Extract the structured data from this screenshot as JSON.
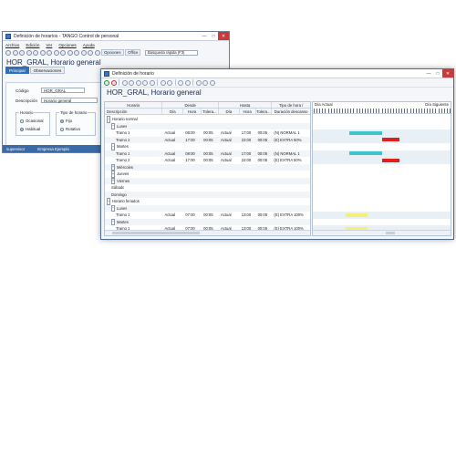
{
  "colors": {
    "teal": "#3fc4cc",
    "red": "#e0201c",
    "yellow": "#f3f07a",
    "accent": "#2f6fb5"
  },
  "bg_window": {
    "title": "Definición de horarios - TANGO Control de personal",
    "menu": [
      "Archivo",
      "Edición",
      "Ver",
      "Opciones",
      "Ayuda"
    ],
    "toolbar": {
      "opciones": "Opciones",
      "office": "Office",
      "search_placeholder": "Búsqueda rápida (F3)"
    },
    "record_title": "HOR_GRAL, Horario general",
    "tabs": [
      "Principal",
      "Observaciones"
    ],
    "form": {
      "codigo_label": "Código",
      "codigo_value": "HOR_GRAL",
      "descripcion_label": "Descripción",
      "descripcion_value": "Horario general",
      "horario_group": "Horario",
      "horario_opt1": "Ocasional",
      "horario_opt2": "Habitual",
      "tipo_group": "Tipo de horario",
      "tipo_opt1": "Fijo",
      "tipo_opt2": "Rotativo"
    },
    "status": {
      "user": "supervisor",
      "company": "Empresa Ejemplo"
    }
  },
  "fg_window": {
    "title": "Definición de horario",
    "record_title": "HOR_GRAL, Horario general",
    "grid": {
      "group_headers": [
        "Horario",
        "Desde",
        "Hasta",
        "Tipo de hora /"
      ],
      "columns": [
        "Descripción",
        "Día",
        "Hora",
        "Tolera...",
        "Día",
        "Hora",
        "Tolera...",
        "Duración descanso"
      ],
      "rows": [
        {
          "indent": 0,
          "exp": "−",
          "desc": "Horario normal",
          "cells": [
            "",
            "",
            "",
            "",
            "",
            "",
            ""
          ]
        },
        {
          "indent": 1,
          "exp": "−",
          "desc": "Lunes",
          "cells": [
            "",
            "",
            "",
            "",
            "",
            "",
            ""
          ]
        },
        {
          "indent": 2,
          "exp": "",
          "desc": "Tramo 1",
          "cells": [
            "Actual",
            "08:00",
            "00:05",
            "Actual",
            "17:00",
            "00:05",
            "(N) NORMAL 1"
          ]
        },
        {
          "indent": 2,
          "exp": "",
          "desc": "Tramo 2",
          "cells": [
            "Actual",
            "17:00",
            "00:05",
            "Actual",
            "22:00",
            "00:05",
            "(E) EXTRA 50%"
          ]
        },
        {
          "indent": 1,
          "exp": "−",
          "desc": "Martes",
          "cells": [
            "",
            "",
            "",
            "",
            "",
            "",
            ""
          ]
        },
        {
          "indent": 2,
          "exp": "",
          "desc": "Tramo 1",
          "cells": [
            "Actual",
            "08:00",
            "00:05",
            "Actual",
            "17:00",
            "00:05",
            "(N) NORMAL 1"
          ]
        },
        {
          "indent": 2,
          "exp": "",
          "desc": "Tramo 2",
          "cells": [
            "Actual",
            "17:00",
            "00:05",
            "Actual",
            "22:00",
            "00:05",
            "(E) EXTRA 50%"
          ]
        },
        {
          "indent": 1,
          "exp": "+",
          "desc": "Miércoles",
          "cells": [
            "",
            "",
            "",
            "",
            "",
            "",
            ""
          ]
        },
        {
          "indent": 1,
          "exp": "+",
          "desc": "Jueves",
          "cells": [
            "",
            "",
            "",
            "",
            "",
            "",
            ""
          ]
        },
        {
          "indent": 1,
          "exp": "+",
          "desc": "Viernes",
          "cells": [
            "",
            "",
            "",
            "",
            "",
            "",
            ""
          ]
        },
        {
          "indent": 1,
          "exp": "",
          "desc": "Sábado",
          "cells": [
            "",
            "",
            "",
            "",
            "",
            "",
            ""
          ]
        },
        {
          "indent": 1,
          "exp": "",
          "desc": "Domingo",
          "cells": [
            "",
            "",
            "",
            "",
            "",
            "",
            ""
          ]
        },
        {
          "indent": 0,
          "exp": "−",
          "desc": "Horario feriados",
          "cells": [
            "",
            "",
            "",
            "",
            "",
            "",
            ""
          ]
        },
        {
          "indent": 1,
          "exp": "−",
          "desc": "Lunes",
          "cells": [
            "",
            "",
            "",
            "",
            "",
            "",
            ""
          ]
        },
        {
          "indent": 2,
          "exp": "",
          "desc": "Tramo 1",
          "cells": [
            "Actual",
            "07:00",
            "00:05",
            "Actual",
            "13:00",
            "00:05",
            "(E) EXTRA 100%"
          ]
        },
        {
          "indent": 1,
          "exp": "−",
          "desc": "Martes",
          "cells": [
            "",
            "",
            "",
            "",
            "",
            "",
            ""
          ]
        },
        {
          "indent": 2,
          "exp": "",
          "desc": "Tramo 1",
          "cells": [
            "Actual",
            "07:00",
            "00:05",
            "Actual",
            "13:00",
            "00:05",
            "(E) EXTRA 100%"
          ]
        }
      ]
    },
    "gantt": {
      "header_left": "Día Actual",
      "header_right": "Día Siguiente",
      "bars": [
        {
          "row": 2,
          "start": "08:00",
          "end": "17:00",
          "color": "teal"
        },
        {
          "row": 3,
          "start": "17:00",
          "end": "22:00",
          "color": "red"
        },
        {
          "row": 5,
          "start": "08:00",
          "end": "17:00",
          "color": "teal"
        },
        {
          "row": 6,
          "start": "17:00",
          "end": "22:00",
          "color": "red"
        },
        {
          "row": 14,
          "start": "07:00",
          "end": "13:00",
          "color": "yellow"
        },
        {
          "row": 16,
          "start": "07:00",
          "end": "13:00",
          "color": "yellow"
        }
      ]
    }
  }
}
